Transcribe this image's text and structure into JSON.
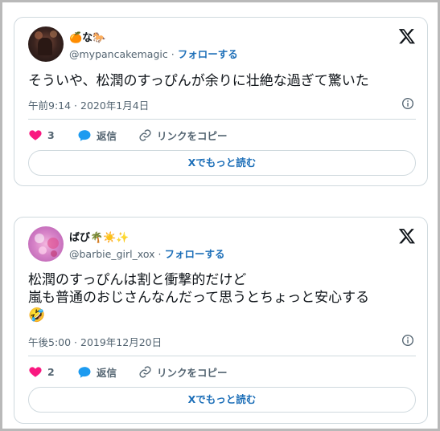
{
  "tweets": [
    {
      "display_name": "🍊な🐎",
      "handle": "@mypancakemagic",
      "separator": "·",
      "follow_label": "フォローする",
      "text_lines": [
        "そういや、松潤のすっぴんが余りに壮絶な過ぎて驚いた"
      ],
      "timestamp": "午前9:14 · 2020年1月4日",
      "like_count": "3",
      "reply_label": "返信",
      "copy_link_label": "リンクをコピー",
      "read_more_label": "Xでもっと読む"
    },
    {
      "display_name": "ばび🌴☀️✨",
      "handle": "@barbie_girl_xox",
      "separator": "·",
      "follow_label": "フォローする",
      "text_lines": [
        "松潤のすっぴんは割と衝撃的だけど",
        "嵐も普通のおじさんなんだって思うとちょっと安心する",
        "🤣"
      ],
      "timestamp": "午後5:00 · 2019年12月20日",
      "like_count": "2",
      "reply_label": "返信",
      "copy_link_label": "リンクをコピー",
      "read_more_label": "Xでもっと読む"
    }
  ],
  "colors": {
    "like": "#f91880",
    "reply": "#1d9bf0",
    "link": "#1d6fb8",
    "muted": "#536471",
    "border": "#cfd9de"
  },
  "icons": {
    "x_logo": "x-logo-icon",
    "like": "heart-icon",
    "reply": "speech-bubble-icon",
    "copy": "link-icon",
    "info": "info-icon"
  }
}
